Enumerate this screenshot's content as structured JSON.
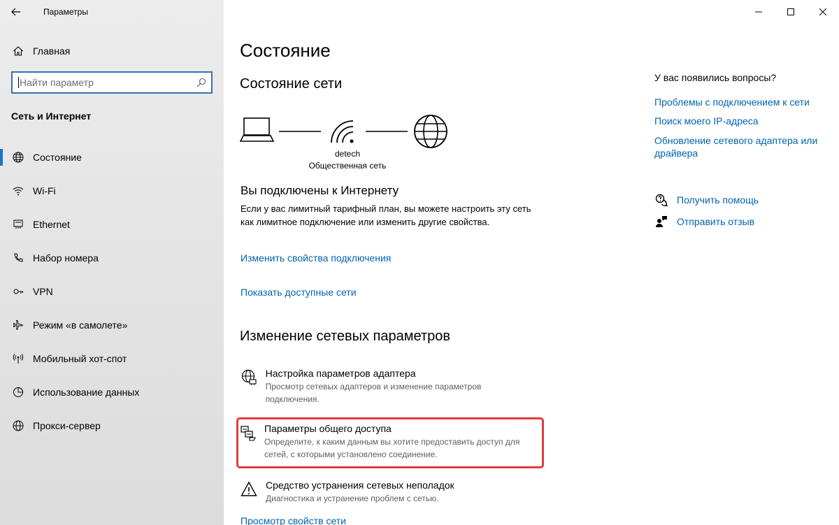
{
  "window": {
    "title": "Параметры"
  },
  "sidebar": {
    "home_label": "Главная",
    "search_placeholder": "Найти параметр",
    "section_title": "Сеть и Интернет",
    "items": [
      {
        "label": "Состояние",
        "icon": "globe-icon",
        "active": true
      },
      {
        "label": "Wi-Fi",
        "icon": "wifi-icon"
      },
      {
        "label": "Ethernet",
        "icon": "ethernet-icon"
      },
      {
        "label": "Набор номера",
        "icon": "dialup-icon"
      },
      {
        "label": "VPN",
        "icon": "vpn-icon"
      },
      {
        "label": "Режим «в самолете»",
        "icon": "airplane-icon"
      },
      {
        "label": "Мобильный хот-спот",
        "icon": "hotspot-icon"
      },
      {
        "label": "Использование данных",
        "icon": "data-usage-icon"
      },
      {
        "label": "Прокси-сервер",
        "icon": "proxy-globe-icon"
      }
    ]
  },
  "main": {
    "title": "Состояние",
    "network_status_heading": "Состояние сети",
    "network_name": "detech",
    "network_type": "Общественная сеть",
    "connected_title": "Вы подключены к Интернету",
    "connected_desc": "Если у вас лимитный тарифный план, вы можете настроить эту сеть как лимитное подключение или изменить другие свойства.",
    "link_change_props": "Изменить свойства подключения",
    "link_show_networks": "Показать доступные сети",
    "change_heading": "Изменение сетевых параметров",
    "settings": [
      {
        "title": "Настройка параметров адаптера",
        "desc": "Просмотр сетевых адаптеров и изменение параметров подключения.",
        "icon": "adapter-globe-icon"
      },
      {
        "title": "Параметры общего доступа",
        "desc": "Определите, к каким данным вы хотите предоставить доступ для сетей, с которыми установлено соединение.",
        "icon": "sharing-icon"
      },
      {
        "title": "Средство устранения сетевых неполадок",
        "desc": "Диагностика и устранение проблем с сетью.",
        "icon": "warning-icon"
      }
    ],
    "link_view_props": "Просмотр свойств сети"
  },
  "side_panel": {
    "question": "У вас появились вопросы?",
    "links": [
      "Проблемы с подключением к сети",
      "Поиск моего IP-адреса",
      "Обновление сетевого адаптера или драйвера"
    ],
    "get_help": "Получить помощь",
    "feedback": "Отправить отзыв"
  },
  "colors": {
    "accent": "#0063b1",
    "highlight": "#e03c3c",
    "active_bar": "#1a73c9"
  }
}
